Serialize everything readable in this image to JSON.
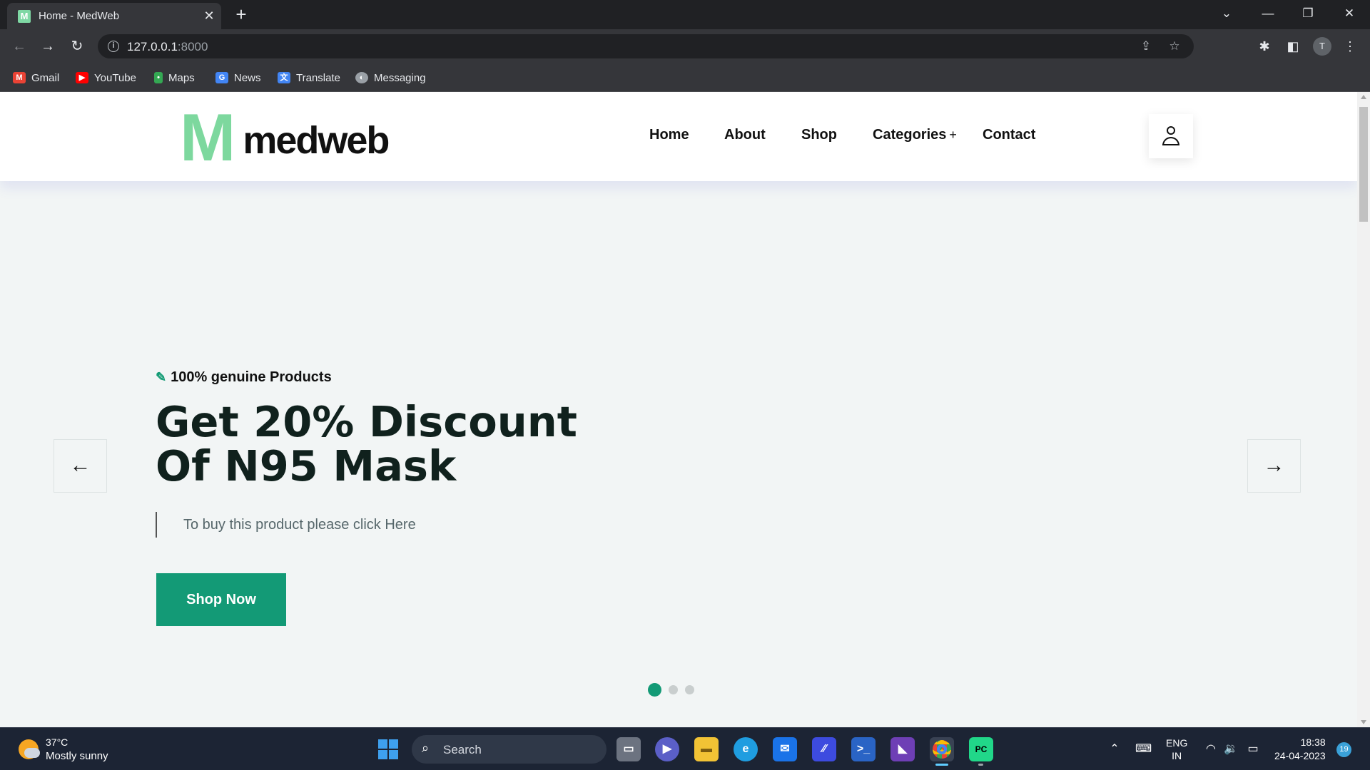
{
  "browser": {
    "tab_title": "Home - MedWeb",
    "tab_favicon": "M",
    "url_host": "127.0.0.1",
    "url_port": ":8000",
    "profile_initial": "T",
    "bookmarks": [
      {
        "label": "Gmail",
        "icon": "gmail-icon",
        "color": "#ea4335"
      },
      {
        "label": "YouTube",
        "icon": "youtube-icon",
        "color": "#ff0000"
      },
      {
        "label": "Maps",
        "icon": "maps-icon",
        "color": "#34a853"
      },
      {
        "label": "News",
        "icon": "news-icon",
        "color": "#4285f4"
      },
      {
        "label": "Translate",
        "icon": "translate-icon",
        "color": "#4285f4"
      },
      {
        "label": "Messaging",
        "icon": "messaging-icon",
        "color": "#9aa0a6"
      }
    ]
  },
  "site": {
    "logo_mark": "M",
    "logo_text": "medweb",
    "nav": {
      "home": "Home",
      "about": "About",
      "shop": "Shop",
      "categories": "Categories",
      "categories_plus": "+",
      "contact": "Contact"
    },
    "hero": {
      "tag": "100% genuine Products",
      "title_line1": "Get 20% Discount",
      "title_line2": "Of N95 Mask",
      "subtitle": "To buy this product please click Here",
      "cta": "Shop Now",
      "prev_arrow": "←",
      "next_arrow": "→",
      "slides_total": 3,
      "active_slide": 1
    },
    "colors": {
      "brand_green": "#139a76",
      "logo_green": "#7dd89e",
      "page_bg": "#f2f5f5"
    }
  },
  "taskbar": {
    "weather_temp": "37°C",
    "weather_desc": "Mostly sunny",
    "search_label": "Search",
    "lang_line1": "ENG",
    "lang_line2": "IN",
    "time": "18:38",
    "date": "24-04-2023",
    "notifications": "19"
  }
}
